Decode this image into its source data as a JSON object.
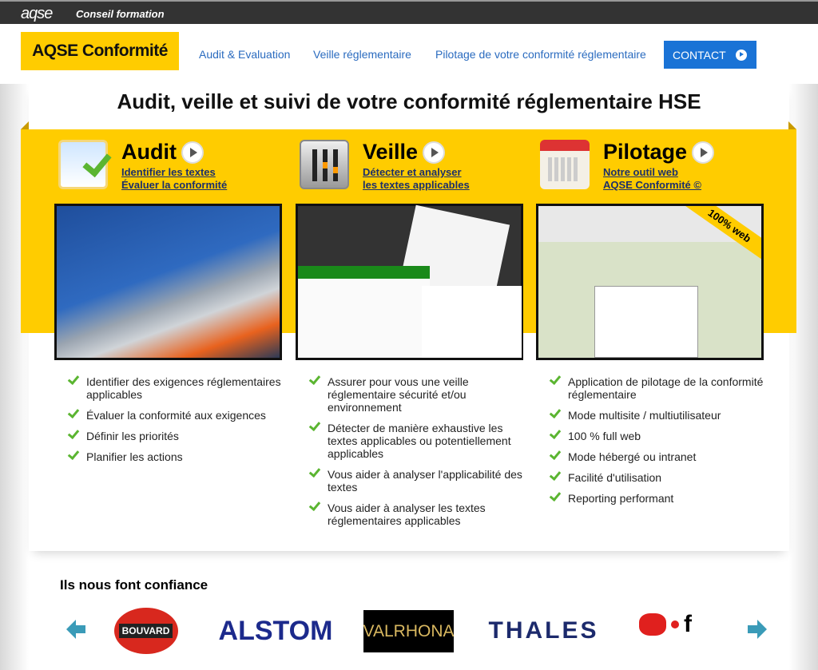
{
  "topbar": {
    "brand": "aqse",
    "tagline": "Conseil formation"
  },
  "header": {
    "logo": "AQSE Conformité",
    "nav": [
      {
        "label": "Audit & Evaluation"
      },
      {
        "label": "Veille réglementaire"
      },
      {
        "label": "Pilotage de votre conformité réglementaire"
      }
    ],
    "contact": "CONTACT"
  },
  "main": {
    "title": "Audit, veille et suivi de votre conformité réglementaire HSE",
    "columns": [
      {
        "title": "Audit",
        "icon": "checklist-icon",
        "links": [
          "Identifier les textes",
          "Évaluer la conformité"
        ],
        "bullets": [
          "Identifier des exigences réglementaires applicables",
          "Évaluer la conformité aux exigences",
          "Définir les priorités",
          "Planifier les actions"
        ]
      },
      {
        "title": "Veille",
        "icon": "sliders-icon",
        "links": [
          "Détecter et analyser",
          "les textes applicables"
        ],
        "bullets": [
          "Assurer pour vous une veille réglementaire sécurité et/ou environnement",
          "Détecter de manière exhaustive les textes applicables ou potentiellement applicables",
          "Vous aider à analyser l'applicabilité des textes",
          "Vous aider à analyser les textes réglementaires applicables"
        ]
      },
      {
        "title": "Pilotage",
        "icon": "calendar-icon",
        "links": [
          "Notre outil web",
          "AQSE Conformité ©"
        ],
        "badge": "100% web",
        "bullets": [
          "Application de pilotage de la conformité réglementaire",
          "Mode multisite / multiutilisateur",
          "100 % full web",
          "Mode hébergé ou intranet",
          "Facilité d'utilisation",
          "Reporting performant"
        ]
      }
    ]
  },
  "clients": {
    "title": "Ils nous font confiance",
    "logos": [
      "BOUVARD",
      "ALSTOM",
      "VALRHONA",
      "THALES",
      "f"
    ]
  },
  "colors": {
    "accent": "#ffcc00",
    "link": "#2a6bbf",
    "contact": "#1a73d6",
    "check": "#5bb531"
  }
}
